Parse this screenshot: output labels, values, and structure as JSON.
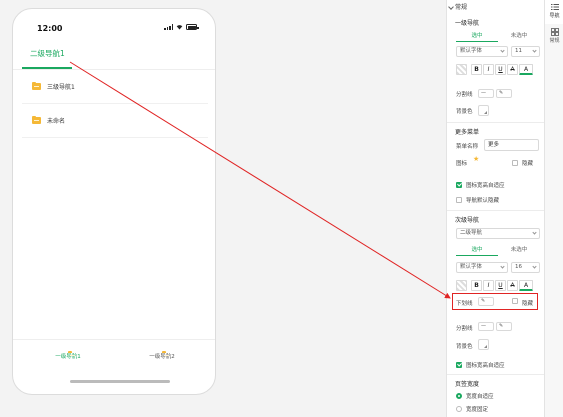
{
  "phone": {
    "status_time": "12:00",
    "tabs": [
      {
        "label": "二级导航1",
        "active": true
      }
    ],
    "sub_items": [
      {
        "label": "三级导航1",
        "icon": "folder-icon"
      },
      {
        "label": "未命名",
        "icon": "folder-icon"
      }
    ],
    "bottom_nav": [
      {
        "label": "一级导航1",
        "active": true,
        "icon": "folder-icon"
      },
      {
        "label": "一级导航2",
        "active": false,
        "icon": "folder-icon"
      }
    ]
  },
  "panel": {
    "section_title": "常规",
    "primary_nav": {
      "heading": "一级导航",
      "segments": [
        "选中",
        "未选中"
      ],
      "font_value": "默认字体",
      "size_value": "11",
      "format_buttons": [
        "B",
        "I",
        "U",
        "A",
        "A"
      ],
      "divider_label": "分割线",
      "bg_label": "背景色"
    },
    "more_menu": {
      "heading": "更多菜单",
      "name_label": "菜单名称",
      "name_value": "更多",
      "icon_label": "图标",
      "hide_label": "隐藏",
      "options": [
        {
          "label": "图标宽高自适应",
          "checked": true
        },
        {
          "label": "导航默认隐藏",
          "checked": false
        }
      ]
    },
    "secondary_nav": {
      "heading": "次级导航",
      "select_value": "二级导航",
      "segments": [
        "选中",
        "未选中"
      ],
      "font_value": "默认字体",
      "size_value": "16",
      "format_buttons": [
        "B",
        "I",
        "U",
        "A",
        "A"
      ],
      "underline_label": "下划线",
      "underline_hide_label": "隐藏",
      "divider_label": "分割线",
      "bg_label": "背景色",
      "adaptive_label": "图标宽高自适应"
    },
    "page_width": {
      "heading": "页签宽度",
      "options": [
        {
          "label": "宽度自适应",
          "selected": true
        },
        {
          "label": "宽度固定",
          "selected": false
        }
      ]
    }
  },
  "side_tabs": [
    {
      "label": "导航",
      "icon": "list-icon",
      "active": true
    },
    {
      "label": "常规",
      "icon": "grid-icon",
      "active": false
    }
  ],
  "colors": {
    "accent": "#1aa85f",
    "highlight": "#e02424",
    "folder": "#f5b836"
  }
}
